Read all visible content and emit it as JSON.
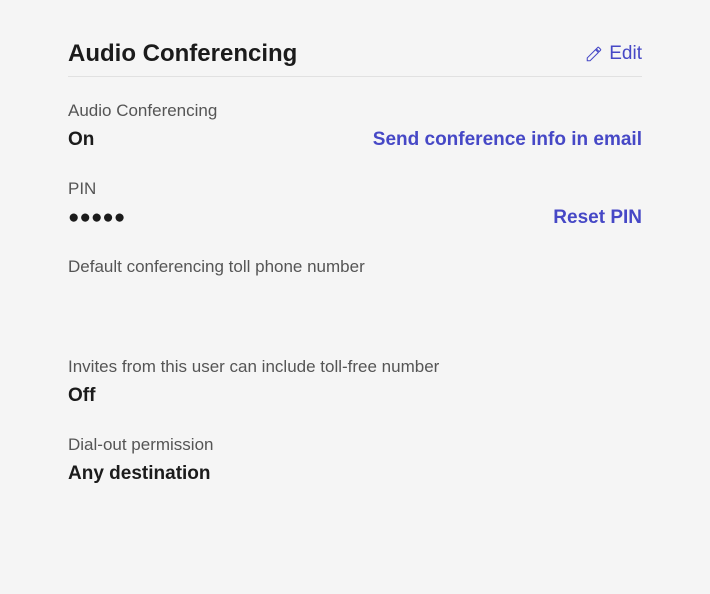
{
  "section": {
    "title": "Audio Conferencing",
    "edit_label": "Edit"
  },
  "audio_conferencing": {
    "label": "Audio Conferencing",
    "value": "On",
    "action_label": "Send conference info in email"
  },
  "pin": {
    "label": "PIN",
    "masked_value": "●●●●●",
    "action_label": "Reset PIN"
  },
  "default_toll": {
    "label": "Default conferencing toll phone number",
    "value": ""
  },
  "toll_free_invites": {
    "label": "Invites from this user can include toll-free number",
    "value": "Off"
  },
  "dial_out": {
    "label": "Dial-out permission",
    "value": "Any destination"
  }
}
